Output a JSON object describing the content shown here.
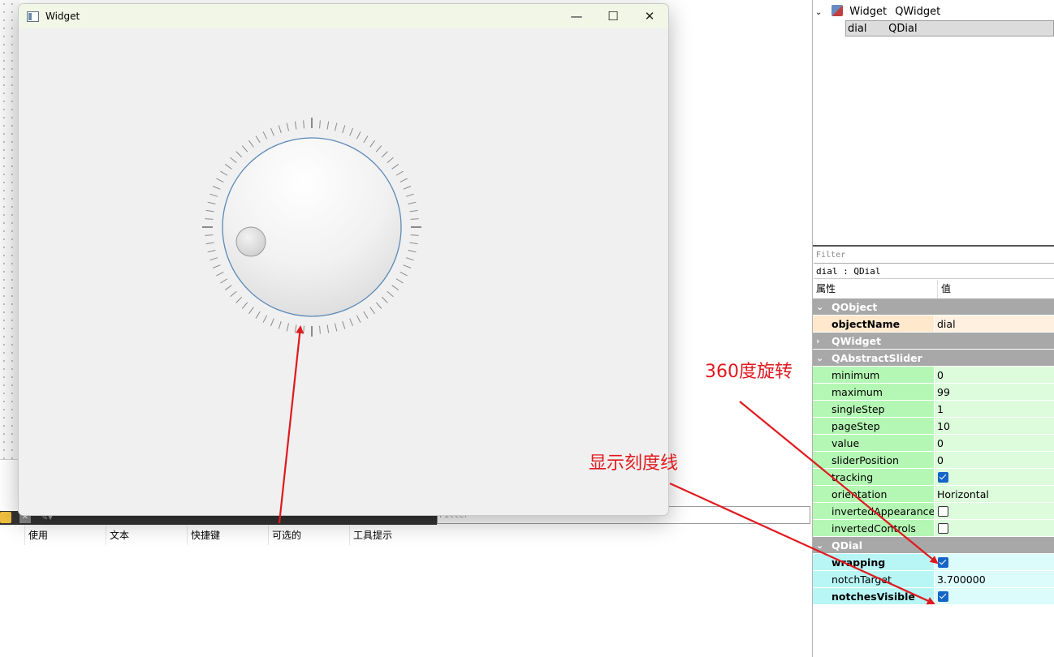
{
  "window": {
    "title": "Widget",
    "minimize": "—",
    "maximize": "☐",
    "close": "✕"
  },
  "object_tree": {
    "rows": [
      {
        "object": "Widget",
        "class": "QWidget"
      },
      {
        "object": "dial",
        "class": "QDial"
      }
    ]
  },
  "action_editor": {
    "filter_placeholder": "Filter",
    "columns": [
      "使用",
      "文本",
      "快捷键",
      "可选的",
      "工具提示"
    ]
  },
  "property_editor": {
    "filter_placeholder": "Filter",
    "object_label": "dial : QDial",
    "col_property": "属性",
    "col_value": "值",
    "rows": [
      {
        "type": "group",
        "name": "QObject",
        "arrow": "v"
      },
      {
        "type": "prop",
        "group": "obj",
        "name": "objectName",
        "value": "dial",
        "bold": true
      },
      {
        "type": "group",
        "name": "QWidget",
        "arrow": ">"
      },
      {
        "type": "group",
        "name": "QAbstractSlider",
        "arrow": "v"
      },
      {
        "type": "prop",
        "group": "slider",
        "name": "minimum",
        "value": "0"
      },
      {
        "type": "prop",
        "group": "slider",
        "name": "maximum",
        "value": "99"
      },
      {
        "type": "prop",
        "group": "slider",
        "name": "singleStep",
        "value": "1"
      },
      {
        "type": "prop",
        "group": "slider",
        "name": "pageStep",
        "value": "10"
      },
      {
        "type": "prop",
        "group": "slider",
        "name": "value",
        "value": "0"
      },
      {
        "type": "prop",
        "group": "slider",
        "name": "sliderPosition",
        "value": "0"
      },
      {
        "type": "prop",
        "group": "slider",
        "name": "tracking",
        "checkbox": true,
        "checked": true
      },
      {
        "type": "prop",
        "group": "slider",
        "name": "orientation",
        "value": "Horizontal"
      },
      {
        "type": "prop",
        "group": "slider",
        "name": "invertedAppearance",
        "checkbox": true,
        "checked": false
      },
      {
        "type": "prop",
        "group": "slider",
        "name": "invertedControls",
        "checkbox": true,
        "checked": false
      },
      {
        "type": "group",
        "name": "QDial",
        "arrow": "v"
      },
      {
        "type": "prop",
        "group": "dial",
        "name": "wrapping",
        "checkbox": true,
        "checked": true,
        "bold": true
      },
      {
        "type": "prop",
        "group": "dial",
        "name": "notchTarget",
        "value": "3.700000"
      },
      {
        "type": "prop",
        "group": "dial",
        "name": "notchesVisible",
        "checkbox": true,
        "checked": true,
        "bold": true
      }
    ]
  },
  "annotations": {
    "rotation": "360度旋转",
    "notches": "显示刻度线"
  },
  "colors": {
    "annotation": "#e0191e",
    "checkbox_checked": "#1565c8"
  }
}
